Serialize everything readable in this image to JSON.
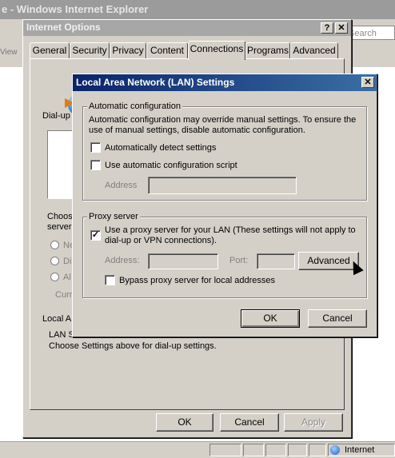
{
  "browser": {
    "title": "e - Windows Internet Explorer",
    "view_label": "View",
    "search_placeholder": "Search",
    "status_zone": "Internet"
  },
  "internet_options": {
    "title": "Internet Options",
    "help_glyph": "?",
    "close_glyph": "✕",
    "tabs": [
      "General",
      "Security",
      "Privacy",
      "Content",
      "Connections",
      "Programs",
      "Advanced"
    ],
    "active_tab": "Connections",
    "dialup_label": "Dial-up",
    "choose_label_1": "Choose",
    "choose_label_2": "server",
    "radio_1": "Ne",
    "radio_2": "Di",
    "radio_3": "Al",
    "current_label": "Curr",
    "local_area_label": "Local A",
    "lan_settings_line1": "LAN S",
    "lan_settings_line2": "Choose Settings above for dial-up settings.",
    "ok_label": "OK",
    "cancel_label": "Cancel",
    "apply_label": "Apply"
  },
  "lan_dialog": {
    "title": "Local Area Network (LAN) Settings",
    "close_glyph": "✕",
    "auto_config": {
      "legend": "Automatic configuration",
      "description": "Automatic configuration may override manual settings.  To ensure the use of manual settings, disable automatic configuration.",
      "auto_detect_label": "Automatically detect settings",
      "auto_detect_checked": false,
      "script_label": "Use automatic configuration script",
      "script_checked": false,
      "address_label": "Address",
      "address_value": ""
    },
    "proxy": {
      "legend": "Proxy server",
      "use_proxy_label": "Use a proxy server for your LAN (These settings will not apply to dial-up or VPN connections).",
      "use_proxy_checked": true,
      "check_glyph": "✓",
      "address_label": "Address:",
      "address_value": "",
      "port_label": "Port:",
      "port_value": "",
      "advanced_label": "Advanced",
      "bypass_label": "Bypass proxy server for local addresses",
      "bypass_checked": false
    },
    "ok_label": "OK",
    "cancel_label": "Cancel"
  }
}
